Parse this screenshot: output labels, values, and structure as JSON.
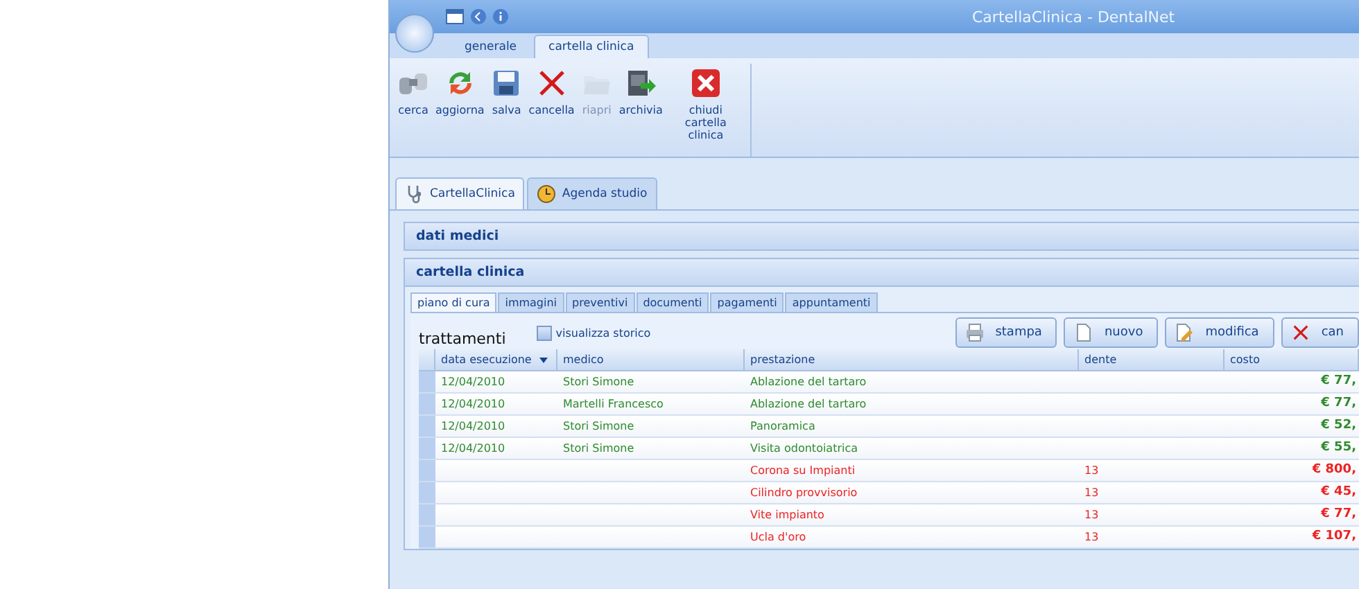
{
  "window": {
    "title": "CartellaClinica - DentalNet"
  },
  "ribbon_tabs": [
    {
      "label": "generale",
      "selected": false
    },
    {
      "label": "cartella clinica",
      "selected": true
    }
  ],
  "ribbon_buttons": [
    {
      "kind": "binoculars",
      "label": "cerca",
      "disabled": false
    },
    {
      "kind": "refresh",
      "label": "aggiorna",
      "disabled": false
    },
    {
      "kind": "save",
      "label": "salva",
      "disabled": false
    },
    {
      "kind": "cross",
      "label": "cancella",
      "disabled": false
    },
    {
      "kind": "folder",
      "label": "riapri",
      "disabled": true
    },
    {
      "kind": "archive",
      "label": "archivia",
      "disabled": false
    },
    {
      "kind": "close",
      "label": "chiudi cartella clinica",
      "disabled": false
    }
  ],
  "document_tabs": [
    {
      "kind": "stethoscope",
      "label": "CartellaClinica",
      "selected": true
    },
    {
      "kind": "clock",
      "label": "Agenda studio",
      "selected": false
    }
  ],
  "panels": [
    {
      "title": "dati medici"
    },
    {
      "title": "cartella clinica"
    }
  ],
  "section_tabs": [
    {
      "label": "piano di cura",
      "selected": true
    },
    {
      "label": "immagini",
      "selected": false
    },
    {
      "label": "preventivi",
      "selected": false
    },
    {
      "label": "documenti",
      "selected": false
    },
    {
      "label": "pagamenti",
      "selected": false
    },
    {
      "label": "appuntamenti",
      "selected": false
    }
  ],
  "treatments": {
    "title": "trattamenti",
    "history_checkbox": {
      "label": "visualizza storico",
      "checked": false
    },
    "actions": [
      {
        "kind": "printer",
        "label": "stampa"
      },
      {
        "kind": "page",
        "label": "nuovo"
      },
      {
        "kind": "edit",
        "label": "modifica"
      },
      {
        "kind": "cross",
        "label": "can"
      }
    ]
  },
  "table": {
    "columns": [
      {
        "label": "data esecuzione",
        "sorted": true
      },
      {
        "label": "medico",
        "sorted": false
      },
      {
        "label": "prestazione",
        "sorted": false
      },
      {
        "label": "dente",
        "sorted": false
      },
      {
        "label": "costo",
        "sorted": false
      }
    ],
    "rows": [
      {
        "color": "#2e8b2e",
        "cells": [
          "12/04/2010",
          "Stori Simone",
          "Ablazione del tartaro",
          "",
          "€ 77,"
        ]
      },
      {
        "color": "#2e8b2e",
        "cells": [
          "12/04/2010",
          "Martelli Francesco",
          "Ablazione del tartaro",
          "",
          "€ 77,"
        ]
      },
      {
        "color": "#2e8b2e",
        "cells": [
          "12/04/2010",
          "Stori Simone",
          "Panoramica",
          "",
          "€ 52,"
        ]
      },
      {
        "color": "#2e8b2e",
        "cells": [
          "12/04/2010",
          "Stori Simone",
          "Visita odontoiatrica",
          "",
          "€ 55,"
        ]
      },
      {
        "color": "#ee2222",
        "cells": [
          "",
          "",
          "Corona su Impianti",
          "13",
          "€ 800,"
        ]
      },
      {
        "color": "#ee2222",
        "cells": [
          "",
          "",
          "Cilindro provvisorio",
          "13",
          "€ 45,"
        ]
      },
      {
        "color": "#ee2222",
        "cells": [
          "",
          "",
          "Vite impianto",
          "13",
          "€ 77,"
        ]
      },
      {
        "color": "#ee2222",
        "cells": [
          "",
          "",
          "Ucla d'oro",
          "13",
          "€ 107,"
        ]
      }
    ]
  }
}
